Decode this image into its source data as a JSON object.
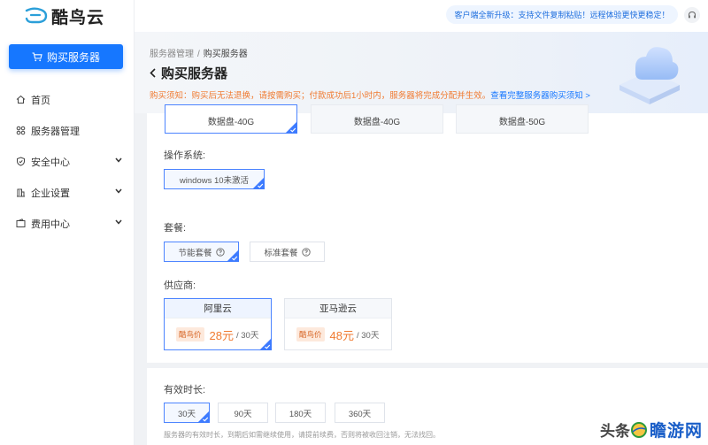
{
  "app": {
    "name": "酷鸟云"
  },
  "sidebar": {
    "buy_button": "购买服务器",
    "items": [
      {
        "label": "首页",
        "icon": "home-icon",
        "expandable": false
      },
      {
        "label": "服务器管理",
        "icon": "server-grid-icon",
        "expandable": false
      },
      {
        "label": "安全中心",
        "icon": "shield-icon",
        "expandable": true
      },
      {
        "label": "企业设置",
        "icon": "building-icon",
        "expandable": true
      },
      {
        "label": "费用中心",
        "icon": "wallet-icon",
        "expandable": true
      }
    ]
  },
  "topbar": {
    "notice": "客户端全新升级：支持文件复制粘贴！远程体验更快更稳定！"
  },
  "header": {
    "breadcrumb": [
      "服务器管理",
      "购买服务器"
    ],
    "title": "购买服务器",
    "notice_text": "购买须知：购买后无法退换，请按需购买；付款成功后1小时内，服务器将完成分配并生效。",
    "notice_link": "查看完整服务器购买须知 >"
  },
  "disk": {
    "options": [
      {
        "label": "数据盘-40G",
        "selected": true
      },
      {
        "label": "数据盘-40G",
        "selected": false
      },
      {
        "label": "数据盘-50G",
        "selected": false
      }
    ]
  },
  "os": {
    "label": "操作系统:",
    "options": [
      {
        "label": "windows 10未激活",
        "selected": true
      }
    ]
  },
  "package": {
    "label": "套餐:",
    "options": [
      {
        "label": "节能套餐",
        "selected": true
      },
      {
        "label": "标准套餐",
        "selected": false
      }
    ]
  },
  "provider": {
    "label": "供应商:",
    "options": [
      {
        "name": "阿里云",
        "tag": "酷鸟价",
        "price": "28元",
        "unit": "/ 30天",
        "selected": true
      },
      {
        "name": "亚马逊云",
        "tag": "酷鸟价",
        "price": "48元",
        "unit": "/ 30天",
        "selected": false
      }
    ]
  },
  "duration": {
    "label": "有效时长:",
    "options": [
      {
        "label": "30天",
        "selected": true
      },
      {
        "label": "90天",
        "selected": false
      },
      {
        "label": "180天",
        "selected": false
      },
      {
        "label": "360天",
        "selected": false
      }
    ],
    "hint": "服务器的有效时长，到期后如需继续使用，请提前续费，否则将被收回注销，无法找回。"
  },
  "watermark": {
    "part1": "头条",
    "part2": "瞻游网"
  },
  "colors": {
    "primary": "#1677ff",
    "warning": "#f07a30"
  }
}
